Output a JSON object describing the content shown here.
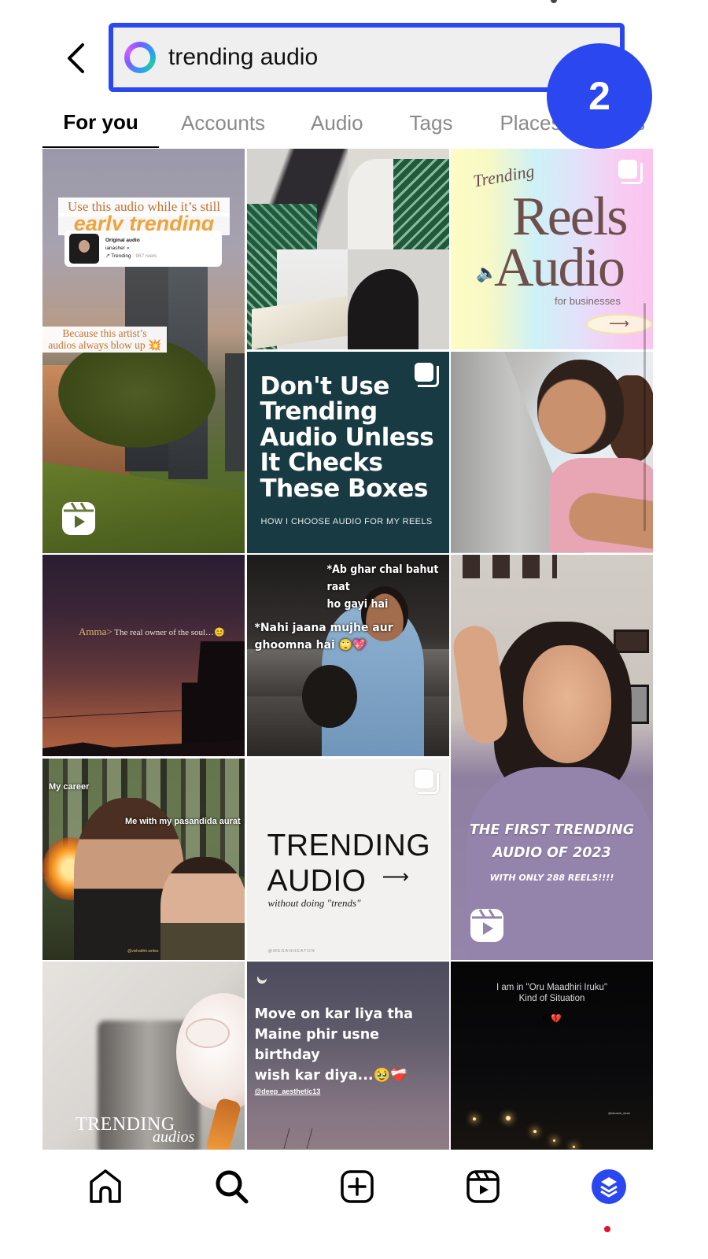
{
  "search": {
    "query": "trending audio",
    "ai_icon": "meta-ai-ring-icon"
  },
  "step_badge": "2",
  "tabs": [
    {
      "label": "For you",
      "active": true
    },
    {
      "label": "Accounts",
      "active": false
    },
    {
      "label": "Audio",
      "active": false
    },
    {
      "label": "Tags",
      "active": false
    },
    {
      "label": "Places",
      "active": false
    },
    {
      "label": "Reels",
      "active": false
    }
  ],
  "grid": {
    "post1": {
      "type": "reel",
      "caption_top_line1": "Use this audio while it’s still",
      "caption_top_line2": "early trending",
      "card_title": "Original audio",
      "card_user": "ianasher",
      "card_meta_trending": "↗ Trending",
      "card_meta_count": "· 987 reels",
      "caption_bottom_line1": "Because this artist’s",
      "caption_bottom_line2": "audios always blow up 💥"
    },
    "post2": {
      "type": "photo-collage"
    },
    "post3": {
      "type": "carousel",
      "script_title": "Trending",
      "title_line1": "Reels",
      "title_line2": "Audio",
      "subtitle": "for businesses",
      "arrow": "⟶"
    },
    "post4": {
      "type": "carousel",
      "headline_lines": [
        "Don't Use",
        "Trending",
        "Audio Unless",
        "It Checks",
        "These Boxes"
      ],
      "subtitle": "HOW I CHOOSE AUDIO FOR MY REELS"
    },
    "post5": {
      "type": "photo"
    },
    "post6": {
      "type": "photo",
      "text_prefix": "Amma>",
      "text": " The real owner of the soul…😊"
    },
    "post7": {
      "type": "photo",
      "text_line1": "*Ab ghar chal bahut raat",
      "text_line2": "ho gayi hai",
      "text_line3": "*Nahi jaana mujhe aur",
      "text_line4": "ghoomna hai 🙄💖"
    },
    "post8": {
      "type": "reel",
      "headline_line1": "THE FIRST TRENDING",
      "headline_line2": "AUDIO OF 2023",
      "subtitle": "WITH ONLY 288 REELS!!!!"
    },
    "post9": {
      "type": "photo",
      "label1": "My career",
      "label2": "Me with my pasandida aurat",
      "watermark": "@vishabhh.writes"
    },
    "post10": {
      "type": "carousel",
      "title_line1": "TRENDING",
      "title_line2": "AUDIO",
      "arrow": "⟶",
      "subtitle": "without doing \"trends\"",
      "watermark": "@MEGANHEATON"
    },
    "post11": {
      "type": "photo",
      "title": "TRENDING",
      "script": "audios"
    },
    "post12": {
      "type": "photo",
      "text_lines": [
        "Move on kar liya tha",
        "Maine phir usne",
        "birthday",
        "wish kar diya...🥹❤️‍🩹"
      ],
      "handle": "@deep_aesthetic13"
    },
    "post13": {
      "type": "photo",
      "text_line1": "I am in \"Oru Maadhiri Iruku\"",
      "text_line2": "Kind of Situation",
      "emoji": "😩💔",
      "watermark": "@ideasth_shah"
    }
  },
  "bottom_nav": [
    {
      "name": "home",
      "icon": "home-icon"
    },
    {
      "name": "search",
      "icon": "search-icon",
      "active": true
    },
    {
      "name": "create",
      "icon": "plus-square-icon"
    },
    {
      "name": "reels",
      "icon": "reels-icon"
    },
    {
      "name": "profile",
      "icon": "buffer-layers-icon",
      "notification": true
    }
  ],
  "colors": {
    "accent_blue": "#2b47f0",
    "notification_red": "#e8102c",
    "search_bg": "#efefef",
    "inactive_tab": "#8a8a8a"
  }
}
